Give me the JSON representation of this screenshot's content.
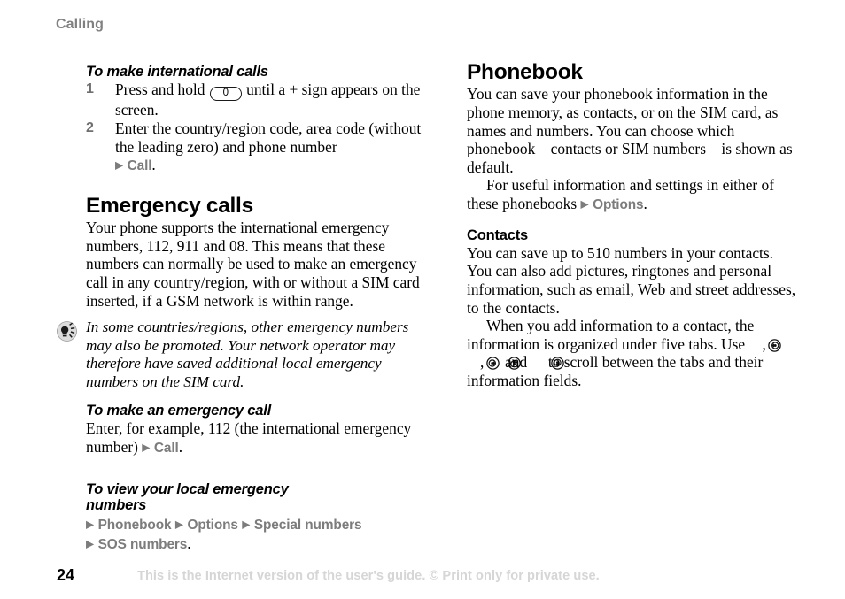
{
  "document": {
    "running_head": "Calling",
    "page_number": "24",
    "footer_note": "This is the Internet version of the user's guide. © Print only for private use."
  },
  "colors": {
    "running_head": "#808080",
    "ui_path": "#7c7c7c",
    "body_text": "#000000",
    "step_number": "#6f6f6f",
    "footer_note": "#d6d6d6",
    "tip_icon_circle": "#d9d9d9"
  },
  "left_column": {
    "task_international": {
      "heading": "To make international calls",
      "steps": [
        {
          "number": "1",
          "text_before_key": "Press and hold ",
          "key_label": "0",
          "text_after_key": " until a + sign appears on the screen."
        },
        {
          "number": "2",
          "text": "Enter the country/region code, area code (without the leading zero) and phone number ",
          "path_arrow": "▶",
          "path_label": "Call",
          "path_trailing": "."
        }
      ]
    },
    "emergency_section": {
      "heading": "Emergency calls",
      "body": "Your phone supports the international emergency numbers, 112, 911 and 08. This means that these numbers can normally be used to make an emergency call in any country/region, with or without a SIM card inserted, if a GSM network is within range."
    },
    "tip": {
      "icon": "lightbulb-tip-icon",
      "text": "In some countries/regions, other emergency numbers may also be promoted. Your network operator may therefore have saved additional local emergency numbers on the SIM card."
    },
    "task_emergency_call": {
      "heading": "To make an emergency call",
      "text_before": "Enter, for example, 112 (the international emergency number) ",
      "path_arrow": "▶",
      "path_label": "Call",
      "path_trailing": "."
    },
    "task_local_numbers": {
      "heading_line1": "To view your local emergency",
      "heading_line2": "numbers",
      "path_line1": [
        {
          "arrow": "▶",
          "label": "Phonebook"
        },
        {
          "arrow": "▶",
          "label": "Options"
        },
        {
          "arrow": "▶",
          "label": "Special numbers"
        }
      ],
      "path_line2": [
        {
          "arrow": "▶",
          "label": "SOS numbers"
        }
      ],
      "path_trailing": "."
    }
  },
  "right_column": {
    "phonebook_section": {
      "heading": "Phonebook",
      "para1": "You can save your phonebook information in the phone memory, as contacts, or on the SIM card, as names and numbers. You can choose which phonebook – contacts or SIM numbers – is shown as default.",
      "para2_before": "For useful information and settings in either of these phonebooks ",
      "para2_arrow": "▶",
      "para2_label": "Options",
      "para2_trailing": "."
    },
    "contacts_section": {
      "heading": "Contacts",
      "para1": "You can save up to 510 numbers in your contacts. You can also add pictures, ringtones and personal information, such as email, Web and street addresses, to the contacts.",
      "para2_part1": "When you add information to a contact, the information is organized under five tabs. Use ",
      "nav_icon_1": "navkey-left-icon",
      "para2_part2": ", ",
      "nav_icon_2": "navkey-right-icon",
      "para2_part3": ", ",
      "nav_icon_3": "navkey-up-icon",
      "para2_part4": " and ",
      "nav_icon_4": "navkey-down-icon",
      "para2_part5": " to scroll between the tabs and their information fields."
    }
  }
}
